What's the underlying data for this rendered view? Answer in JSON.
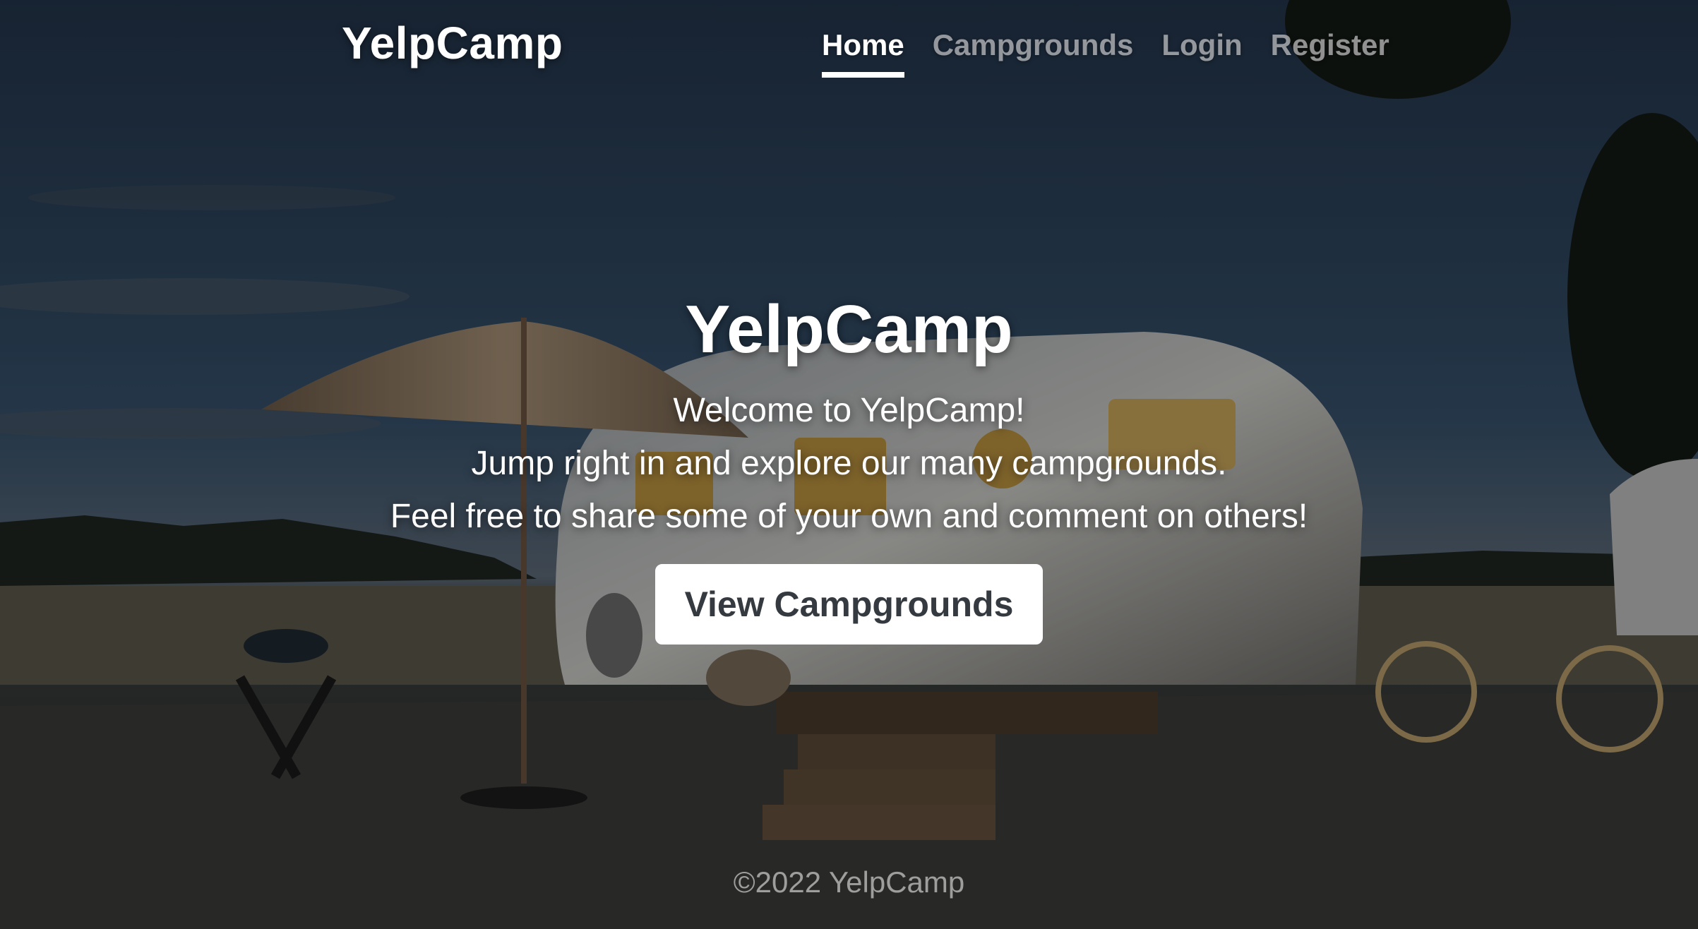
{
  "header": {
    "brand": "YelpCamp",
    "nav": [
      {
        "label": "Home",
        "active": true
      },
      {
        "label": "Campgrounds",
        "active": false
      },
      {
        "label": "Login",
        "active": false
      },
      {
        "label": "Register",
        "active": false
      }
    ]
  },
  "hero": {
    "title": "YelpCamp",
    "lines": [
      "Welcome to YelpCamp!",
      "Jump right in and explore our many campgrounds.",
      "Feel free to share some of your own and comment on others!"
    ],
    "button_label": "View Campgrounds"
  },
  "footer": {
    "text": "©2022 YelpCamp"
  },
  "colors": {
    "sky": "#2b3d52",
    "button_bg": "#ffffff",
    "button_text": "#343a40",
    "nav_active": "#ffffff"
  }
}
